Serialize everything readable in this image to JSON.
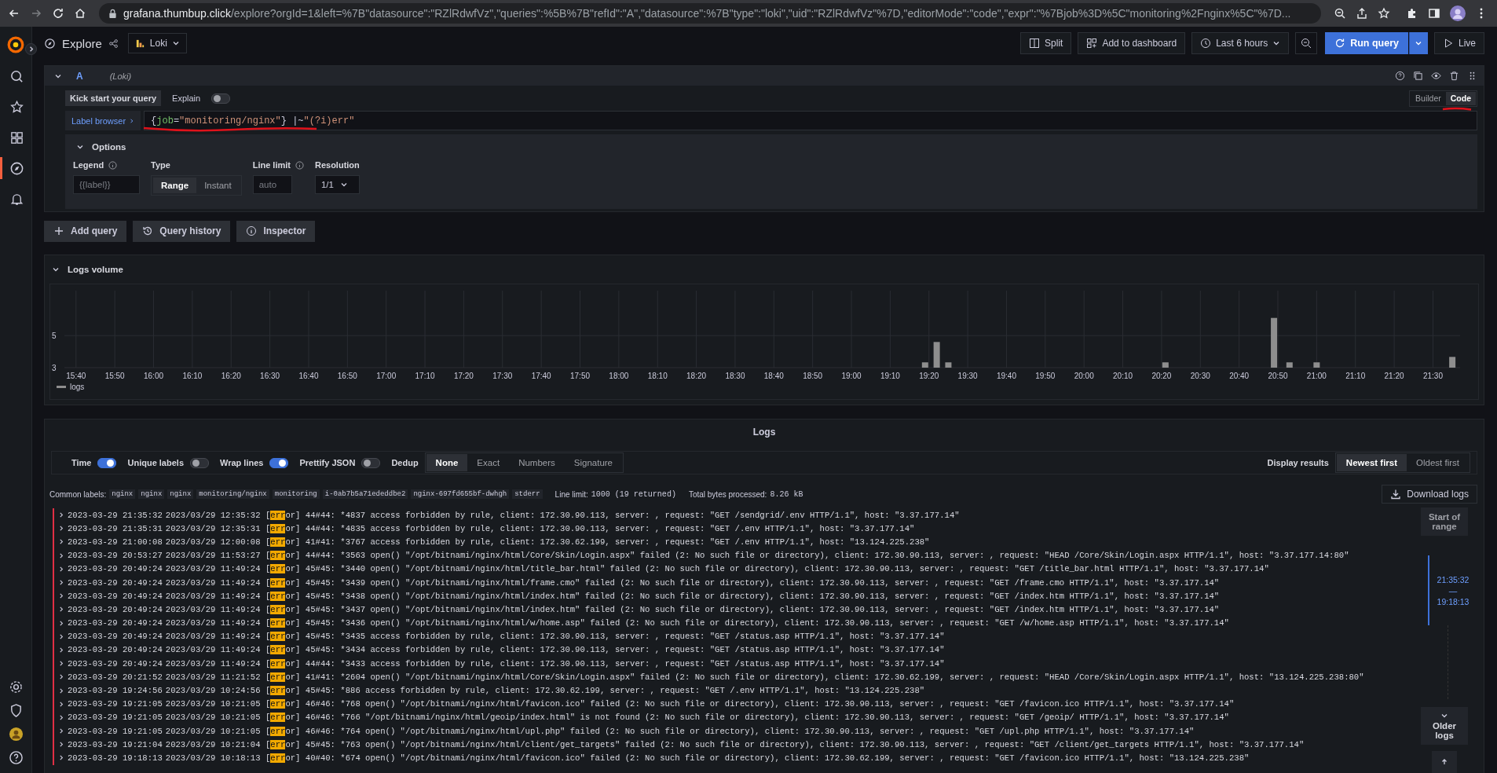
{
  "browser": {
    "host": "grafana.thumbup.click",
    "path": "/explore?orgId=1&left=%7B\"datasource\":\"RZlRdwfVz\",\"queries\":%5B%7B\"refId\":\"A\",\"datasource\":%7B\"type\":\"loki\",\"uid\":\"RZlRdwfVz\"%7D,\"editorMode\":\"code\",\"expr\":\"%7Bjob%3D%5C\"monitoring%2Fnginx%5C\"%7D..."
  },
  "sidebar": {
    "items": [
      {
        "selected": false
      },
      {
        "selected": false
      },
      {
        "selected": false
      },
      {
        "selected": true
      },
      {
        "selected": false
      }
    ]
  },
  "topbar": {
    "title": "Explore",
    "datasource": "Loki",
    "actions": [
      "Split",
      "Add to dashboard"
    ],
    "time_range": "Last 6 hours",
    "run": "Run query",
    "live": "Live"
  },
  "query": {
    "ref": "A",
    "source": "(Loki)",
    "kick_start": "Kick start your query",
    "explain": {
      "label": "Explain",
      "on": false
    },
    "modes": [
      {
        "label": "Builder",
        "selected": false
      },
      {
        "label": "Code",
        "selected": true
      }
    ],
    "label_browser": "Label browser",
    "expr": [
      {
        "kind": "punct",
        "text": "{"
      },
      {
        "kind": "label",
        "text": "job"
      },
      {
        "kind": "punct",
        "text": "="
      },
      {
        "kind": "string",
        "text": "\"monitoring/nginx\""
      },
      {
        "kind": "punct",
        "text": "} "
      },
      {
        "kind": "op",
        "text": "|~"
      },
      {
        "kind": "string",
        "text": "\"(?i)err\""
      }
    ],
    "options": {
      "title": "Options",
      "legend": {
        "label": "Legend",
        "placeholder": "{{label}}"
      },
      "type": {
        "label": "Type",
        "choices": [
          {
            "label": "Range",
            "selected": true
          },
          {
            "label": "Instant",
            "selected": false
          }
        ]
      },
      "line_limit": {
        "label": "Line limit",
        "placeholder": "auto"
      },
      "resolution": {
        "label": "Resolution",
        "value": "1/1"
      }
    }
  },
  "query_buttons": [
    "Add query",
    "Query history",
    "Inspector"
  ],
  "logs_volume": {
    "title": "Logs volume",
    "chart_data": {
      "type": "bar",
      "x": [
        1159,
        1162,
        1165,
        1221,
        1249,
        1253,
        1260,
        1295
      ],
      "series": [
        {
          "name": "logs",
          "color": "#8e8e8e",
          "values": [
            3.33,
            4.6,
            3.33,
            3.33,
            6.1,
            3.33,
            3.33,
            3.67
          ]
        }
      ],
      "xlim": [
        937,
        1297
      ],
      "ylim": [
        3,
        7.8
      ],
      "yticks": [
        3,
        5
      ],
      "grid": true,
      "xticks": [
        {
          "value": 940,
          "label": "15:40"
        },
        {
          "value": 950,
          "label": "15:50"
        },
        {
          "value": 960,
          "label": "16:00"
        },
        {
          "value": 970,
          "label": "16:10"
        },
        {
          "value": 980,
          "label": "16:20"
        },
        {
          "value": 990,
          "label": "16:30"
        },
        {
          "value": 1000,
          "label": "16:40"
        },
        {
          "value": 1010,
          "label": "16:50"
        },
        {
          "value": 1020,
          "label": "17:00"
        },
        {
          "value": 1030,
          "label": "17:10"
        },
        {
          "value": 1040,
          "label": "17:20"
        },
        {
          "value": 1050,
          "label": "17:30"
        },
        {
          "value": 1060,
          "label": "17:40"
        },
        {
          "value": 1070,
          "label": "17:50"
        },
        {
          "value": 1080,
          "label": "18:00"
        },
        {
          "value": 1090,
          "label": "18:10"
        },
        {
          "value": 1100,
          "label": "18:20"
        },
        {
          "value": 1110,
          "label": "18:30"
        },
        {
          "value": 1120,
          "label": "18:40"
        },
        {
          "value": 1130,
          "label": "18:50"
        },
        {
          "value": 1140,
          "label": "19:00"
        },
        {
          "value": 1150,
          "label": "19:10"
        },
        {
          "value": 1160,
          "label": "19:20"
        },
        {
          "value": 1170,
          "label": "19:30"
        },
        {
          "value": 1180,
          "label": "19:40"
        },
        {
          "value": 1190,
          "label": "19:50"
        },
        {
          "value": 1200,
          "label": "20:00"
        },
        {
          "value": 1210,
          "label": "20:10"
        },
        {
          "value": 1220,
          "label": "20:20"
        },
        {
          "value": 1230,
          "label": "20:30"
        },
        {
          "value": 1240,
          "label": "20:40"
        },
        {
          "value": 1250,
          "label": "20:50"
        },
        {
          "value": 1260,
          "label": "21:00"
        },
        {
          "value": 1270,
          "label": "21:10"
        },
        {
          "value": 1280,
          "label": "21:20"
        },
        {
          "value": 1290,
          "label": "21:30"
        }
      ]
    }
  },
  "logs": {
    "title": "Logs",
    "toggles": [
      {
        "label": "Time",
        "on": true
      },
      {
        "label": "Unique labels",
        "on": false
      },
      {
        "label": "Wrap lines",
        "on": true
      },
      {
        "label": "Prettify JSON",
        "on": false
      }
    ],
    "dedup": {
      "label": "Dedup",
      "options": [
        {
          "label": "None",
          "selected": true
        },
        {
          "label": "Exact",
          "selected": false
        },
        {
          "label": "Numbers",
          "selected": false
        },
        {
          "label": "Signature",
          "selected": false
        }
      ]
    },
    "order": {
      "label": "Display results",
      "options": [
        {
          "label": "Newest first",
          "selected": true
        },
        {
          "label": "Oldest first",
          "selected": false
        }
      ]
    },
    "common_labels": {
      "label": "Common labels:",
      "values": [
        "nginx",
        "nginx",
        "nginx",
        "monitoring/nginx",
        "monitoring",
        "i-0ab7b5a71ededdbe2",
        "nginx-697fd655bf-dwhgh",
        "stderr"
      ]
    },
    "line_limit": {
      "label": "Line limit:",
      "value": "1000 (19 returned)"
    },
    "bytes": {
      "label": "Total bytes processed:",
      "value": "8.26 kB"
    },
    "download": "Download logs",
    "rows": [
      {
        "color": "#e02f44",
        "time": "2023-03-29 21:35:32",
        "before": "2023/03/29 12:35:32 [",
        "match": "err",
        "after": "or] 44#44: *4837 access forbidden by rule, client: 172.30.90.113, server: , request: \"GET /sendgrid/.env HTTP/1.1\", host: \"3.37.177.14\""
      },
      {
        "color": "#e02f44",
        "time": "2023-03-29 21:35:31",
        "before": "2023/03/29 12:35:31 [",
        "match": "err",
        "after": "or] 44#44: *4835 access forbidden by rule, client: 172.30.90.113, server: , request: \"GET /.env HTTP/1.1\", host: \"3.37.177.14\""
      },
      {
        "color": "#e02f44",
        "time": "2023-03-29 21:00:08",
        "before": "2023/03/29 12:00:08 [",
        "match": "err",
        "after": "or] 41#41: *3767 access forbidden by rule, client: 172.30.62.199, server: , request: \"GET /.env HTTP/1.1\", host: \"13.124.225.238\""
      },
      {
        "color": "#e02f44",
        "time": "2023-03-29 20:53:27",
        "before": "2023/03/29 11:53:27 [",
        "match": "err",
        "after": "or] 44#44: *3563 open() \"/opt/bitnami/nginx/html/Core/Skin/Login.aspx\" failed (2: No such file or directory), client: 172.30.90.113, server: , request: \"HEAD /Core/Skin/Login.aspx HTTP/1.1\", host: \"3.37.177.14:80\""
      },
      {
        "color": "#e02f44",
        "time": "2023-03-29 20:49:24",
        "before": "2023/03/29 11:49:24 [",
        "match": "err",
        "after": "or] 45#45: *3440 open() \"/opt/bitnami/nginx/html/title_bar.html\" failed (2: No such file or directory), client: 172.30.90.113, server: , request: \"GET /title_bar.html HTTP/1.1\", host: \"3.37.177.14\""
      },
      {
        "color": "#e02f44",
        "time": "2023-03-29 20:49:24",
        "before": "2023/03/29 11:49:24 [",
        "match": "err",
        "after": "or] 45#45: *3439 open() \"/opt/bitnami/nginx/html/frame.cmo\" failed (2: No such file or directory), client: 172.30.90.113, server: , request: \"GET /frame.cmo HTTP/1.1\", host: \"3.37.177.14\""
      },
      {
        "color": "#e02f44",
        "time": "2023-03-29 20:49:24",
        "before": "2023/03/29 11:49:24 [",
        "match": "err",
        "after": "or] 45#45: *3438 open() \"/opt/bitnami/nginx/html/index.htm\" failed (2: No such file or directory), client: 172.30.90.113, server: , request: \"GET /index.htm HTTP/1.1\", host: \"3.37.177.14\""
      },
      {
        "color": "#e02f44",
        "time": "2023-03-29 20:49:24",
        "before": "2023/03/29 11:49:24 [",
        "match": "err",
        "after": "or] 45#45: *3437 open() \"/opt/bitnami/nginx/html/index.htm\" failed (2: No such file or directory), client: 172.30.90.113, server: , request: \"GET /index.htm HTTP/1.1\", host: \"3.37.177.14\""
      },
      {
        "color": "#e02f44",
        "time": "2023-03-29 20:49:24",
        "before": "2023/03/29 11:49:24 [",
        "match": "err",
        "after": "or] 45#45: *3436 open() \"/opt/bitnami/nginx/html/w/home.asp\" failed (2: No such file or directory), client: 172.30.90.113, server: , request: \"GET /w/home.asp HTTP/1.1\", host: \"3.37.177.14\""
      },
      {
        "color": "#e02f44",
        "time": "2023-03-29 20:49:24",
        "before": "2023/03/29 11:49:24 [",
        "match": "err",
        "after": "or] 45#45: *3435 access forbidden by rule, client: 172.30.90.113, server: , request: \"GET /status.asp HTTP/1.1\", host: \"3.37.177.14\""
      },
      {
        "color": "#e02f44",
        "time": "2023-03-29 20:49:24",
        "before": "2023/03/29 11:49:24 [",
        "match": "err",
        "after": "or] 45#45: *3434 access forbidden by rule, client: 172.30.90.113, server: , request: \"GET /status.asp HTTP/1.1\", host: \"3.37.177.14\""
      },
      {
        "color": "#e02f44",
        "time": "2023-03-29 20:49:24",
        "before": "2023/03/29 11:49:24 [",
        "match": "err",
        "after": "or] 44#44: *3433 access forbidden by rule, client: 172.30.90.113, server: , request: \"GET /status.asp HTTP/1.1\", host: \"3.37.177.14\""
      },
      {
        "color": "#e02f44",
        "time": "2023-03-29 20:21:52",
        "before": "2023/03/29 11:21:52 [",
        "match": "err",
        "after": "or] 41#41: *2604 open() \"/opt/bitnami/nginx/html/Core/Skin/Login.aspx\" failed (2: No such file or directory), client: 172.30.62.199, server: , request: \"HEAD /Core/Skin/Login.aspx HTTP/1.1\", host: \"13.124.225.238:80\""
      },
      {
        "color": "#e02f44",
        "time": "2023-03-29 19:24:56",
        "before": "2023/03/29 10:24:56 [",
        "match": "err",
        "after": "or] 45#45: *886 access forbidden by rule, client: 172.30.62.199, server: , request: \"GET /.env HTTP/1.1\", host: \"13.124.225.238\""
      },
      {
        "color": "#e02f44",
        "time": "2023-03-29 19:21:05",
        "before": "2023/03/29 10:21:05 [",
        "match": "err",
        "after": "or] 46#46: *768 open() \"/opt/bitnami/nginx/html/favicon.ico\" failed (2: No such file or directory), client: 172.30.90.113, server: , request: \"GET /favicon.ico HTTP/1.1\", host: \"3.37.177.14\""
      },
      {
        "color": "#e02f44",
        "time": "2023-03-29 19:21:05",
        "before": "2023/03/29 10:21:05 [",
        "match": "err",
        "after": "or] 46#46: *766 \"/opt/bitnami/nginx/html/geoip/index.html\" is not found (2: No such file or directory), client: 172.30.90.113, server: , request: \"GET /geoip/ HTTP/1.1\", host: \"3.37.177.14\""
      },
      {
        "color": "#e02f44",
        "time": "2023-03-29 19:21:05",
        "before": "2023/03/29 10:21:05 [",
        "match": "err",
        "after": "or] 46#46: *764 open() \"/opt/bitnami/nginx/html/upl.php\" failed (2: No such file or directory), client: 172.30.90.113, server: , request: \"GET /upl.php HTTP/1.1\", host: \"3.37.177.14\""
      },
      {
        "color": "#e02f44",
        "time": "2023-03-29 19:21:04",
        "before": "2023/03/29 10:21:04 [",
        "match": "err",
        "after": "or] 45#45: *763 open() \"/opt/bitnami/nginx/html/client/get_targets\" failed (2: No such file or directory), client: 172.30.90.113, server: , request: \"GET /client/get_targets HTTP/1.1\", host: \"3.37.177.14\""
      },
      {
        "color": "#e02f44",
        "time": "2023-03-29 19:18:13",
        "before": "2023/03/29 10:18:13 [",
        "match": "err",
        "after": "or] 40#40: *674 open() \"/opt/bitnami/nginx/html/favicon.ico\" failed (2: No such file or directory), client: 172.30.62.199, server: , request: \"GET /favicon.ico HTTP/1.1\", host: \"13.124.225.238\""
      }
    ],
    "nav": {
      "start": "Start of range",
      "range_from": "21:35:32",
      "range_sep": "—",
      "range_to": "19:18:13",
      "older": "Older logs"
    }
  }
}
